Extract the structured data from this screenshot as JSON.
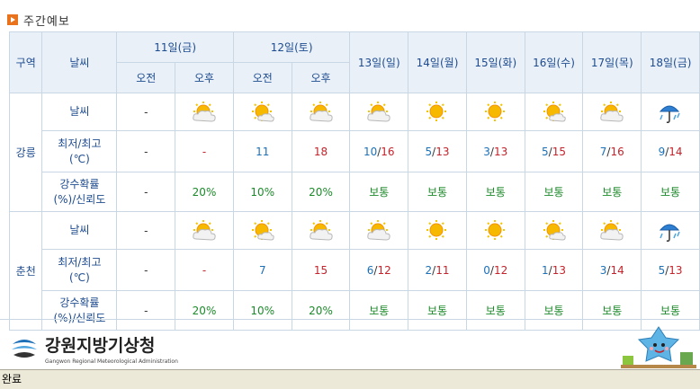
{
  "header": {
    "title": "주간예보"
  },
  "table": {
    "col_region": "구역",
    "col_weather": "날씨",
    "days_split": [
      {
        "label": "11일(금)",
        "am": "오전",
        "pm": "오후"
      },
      {
        "label": "12일(토)",
        "am": "오전",
        "pm": "오후"
      }
    ],
    "days": [
      "13일(일)",
      "14일(월)",
      "15일(화)",
      "16일(수)",
      "17일(목)",
      "18일(금)"
    ],
    "row_labels": {
      "weather": "날씨",
      "temp_l1": "최저/최고",
      "temp_l2": "(℃)",
      "prob_l1": "강수확률",
      "prob_l2": "(%)/신뢰도"
    },
    "regions": [
      {
        "name": "강릉",
        "weather": [
          "-",
          "partly-cloudy-icon",
          "mostly-sunny-icon",
          "partly-cloudy-icon",
          "partly-cloudy-icon",
          "sunny-icon",
          "sunny-icon",
          "mostly-sunny-icon",
          "partly-cloudy-icon",
          "rain-umbrella-icon"
        ],
        "t_am11": "-",
        "t_pm11": "-",
        "t_am12": "11",
        "t_pm12": "18",
        "temps": [
          [
            "10",
            "16"
          ],
          [
            "5",
            "13"
          ],
          [
            "3",
            "13"
          ],
          [
            "5",
            "15"
          ],
          [
            "7",
            "16"
          ],
          [
            "9",
            "14"
          ]
        ],
        "p_am11": "-",
        "p_pm11": "20%",
        "p_am12": "10%",
        "p_pm12": "20%",
        "probs": [
          "보통",
          "보통",
          "보통",
          "보통",
          "보통",
          "보통"
        ]
      },
      {
        "name": "춘천",
        "weather": [
          "-",
          "partly-cloudy-icon",
          "mostly-sunny-icon",
          "partly-cloudy-icon",
          "partly-cloudy-icon",
          "sunny-icon",
          "sunny-icon",
          "mostly-sunny-icon",
          "partly-cloudy-icon",
          "rain-umbrella-icon"
        ],
        "t_am11": "-",
        "t_pm11": "-",
        "t_am12": "7",
        "t_pm12": "15",
        "temps": [
          [
            "6",
            "12"
          ],
          [
            "2",
            "11"
          ],
          [
            "0",
            "12"
          ],
          [
            "1",
            "13"
          ],
          [
            "3",
            "14"
          ],
          [
            "5",
            "13"
          ]
        ],
        "p_am11": "-",
        "p_pm11": "20%",
        "p_am12": "10%",
        "p_pm12": "20%",
        "probs": [
          "보통",
          "보통",
          "보통",
          "보통",
          "보통",
          "보통"
        ]
      }
    ]
  },
  "footer": {
    "org_name": "강원지방기상청",
    "org_sub": "Gangwon Regional Meteorological Administration"
  },
  "status": {
    "text": "완료"
  },
  "colors": {
    "header_bg": "#e9f0f8",
    "header_text": "#1d4b8f",
    "border": "#c9d6e3",
    "min": "#1b70b7",
    "max": "#c4232b",
    "prob": "#1c8a2a"
  }
}
